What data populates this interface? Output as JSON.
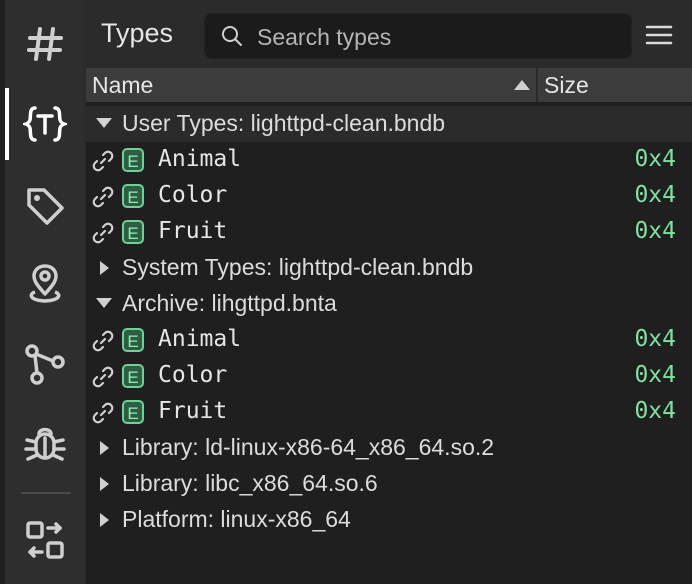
{
  "header": {
    "title": "Types",
    "search_placeholder": "Search types"
  },
  "table": {
    "col_name": "Name",
    "col_size": "Size"
  },
  "groups": {
    "user": "User Types: lighttpd-clean.bndb",
    "system": "System Types: lighttpd-clean.bndb",
    "archive": "Archive: lihgttpd.bnta",
    "lib1": "Library: ld-linux-x86-64_x86_64.so.2",
    "lib2": "Library: libc_x86_64.so.6",
    "platform": "Platform: linux-x86_64"
  },
  "user_types": [
    {
      "badge": "E",
      "name": "Animal",
      "size": "0x4"
    },
    {
      "badge": "E",
      "name": "Color",
      "size": "0x4"
    },
    {
      "badge": "E",
      "name": "Fruit",
      "size": "0x4"
    }
  ],
  "archive_types": [
    {
      "badge": "E",
      "name": "Animal",
      "size": "0x4"
    },
    {
      "badge": "E",
      "name": "Color",
      "size": "0x4"
    },
    {
      "badge": "E",
      "name": "Fruit",
      "size": "0x4"
    }
  ],
  "rail_icons": [
    "hash-icon",
    "types-icon",
    "tag-icon",
    "location-pin-icon",
    "graph-icon",
    "bug-icon",
    "transfer-icon"
  ],
  "colors": {
    "enum_badge": "#6ed197",
    "size_text": "#7fe0a0"
  }
}
